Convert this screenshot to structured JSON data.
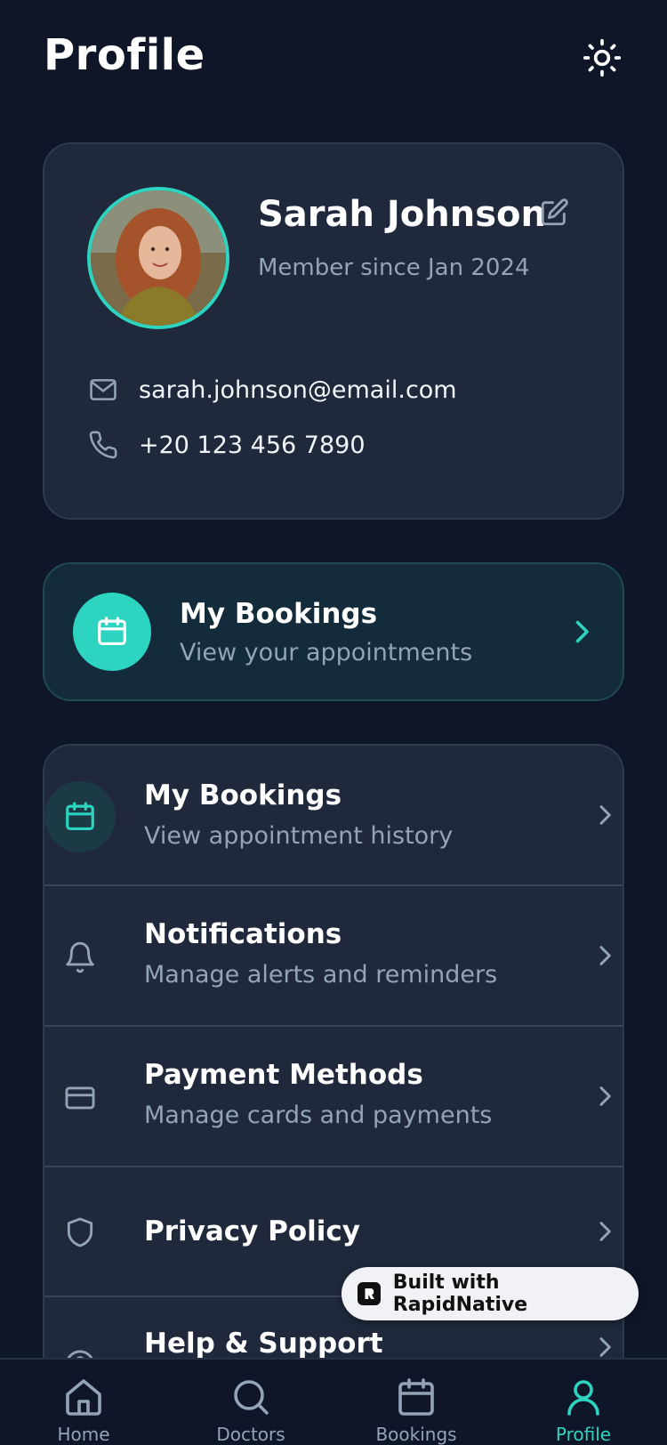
{
  "header": {
    "title": "Profile",
    "theme_icon": "sun-icon"
  },
  "profile": {
    "name": "Sarah Johnson",
    "member_since": "Member since Jan 2024",
    "email": "sarah.johnson@email.com",
    "phone": "+20 123 456 7890"
  },
  "bookings_card": {
    "title": "My Bookings",
    "subtitle": "View your appointments"
  },
  "menu": {
    "items": [
      {
        "title": "My Bookings",
        "subtitle": "View appointment history",
        "icon": "calendar-icon"
      },
      {
        "title": "Notifications",
        "subtitle": "Manage alerts and reminders",
        "icon": "bell-icon"
      },
      {
        "title": "Payment Methods",
        "subtitle": "Manage cards and payments",
        "icon": "credit-card-icon"
      },
      {
        "title": "Privacy Policy",
        "subtitle": "",
        "icon": "shield-icon"
      },
      {
        "title": "Help & Support",
        "subtitle": "",
        "icon": "help-icon"
      }
    ]
  },
  "badge": {
    "text": "Built with RapidNative"
  },
  "tabs": [
    {
      "label": "Home",
      "icon": "home-icon"
    },
    {
      "label": "Doctors",
      "icon": "search-icon"
    },
    {
      "label": "Bookings",
      "icon": "calendar-icon"
    },
    {
      "label": "Profile",
      "icon": "user-icon",
      "active": true
    }
  ],
  "colors": {
    "accent": "#2dd4bf",
    "background": "#0e1628",
    "card": "#1f293b",
    "muted": "#94a3b8"
  }
}
